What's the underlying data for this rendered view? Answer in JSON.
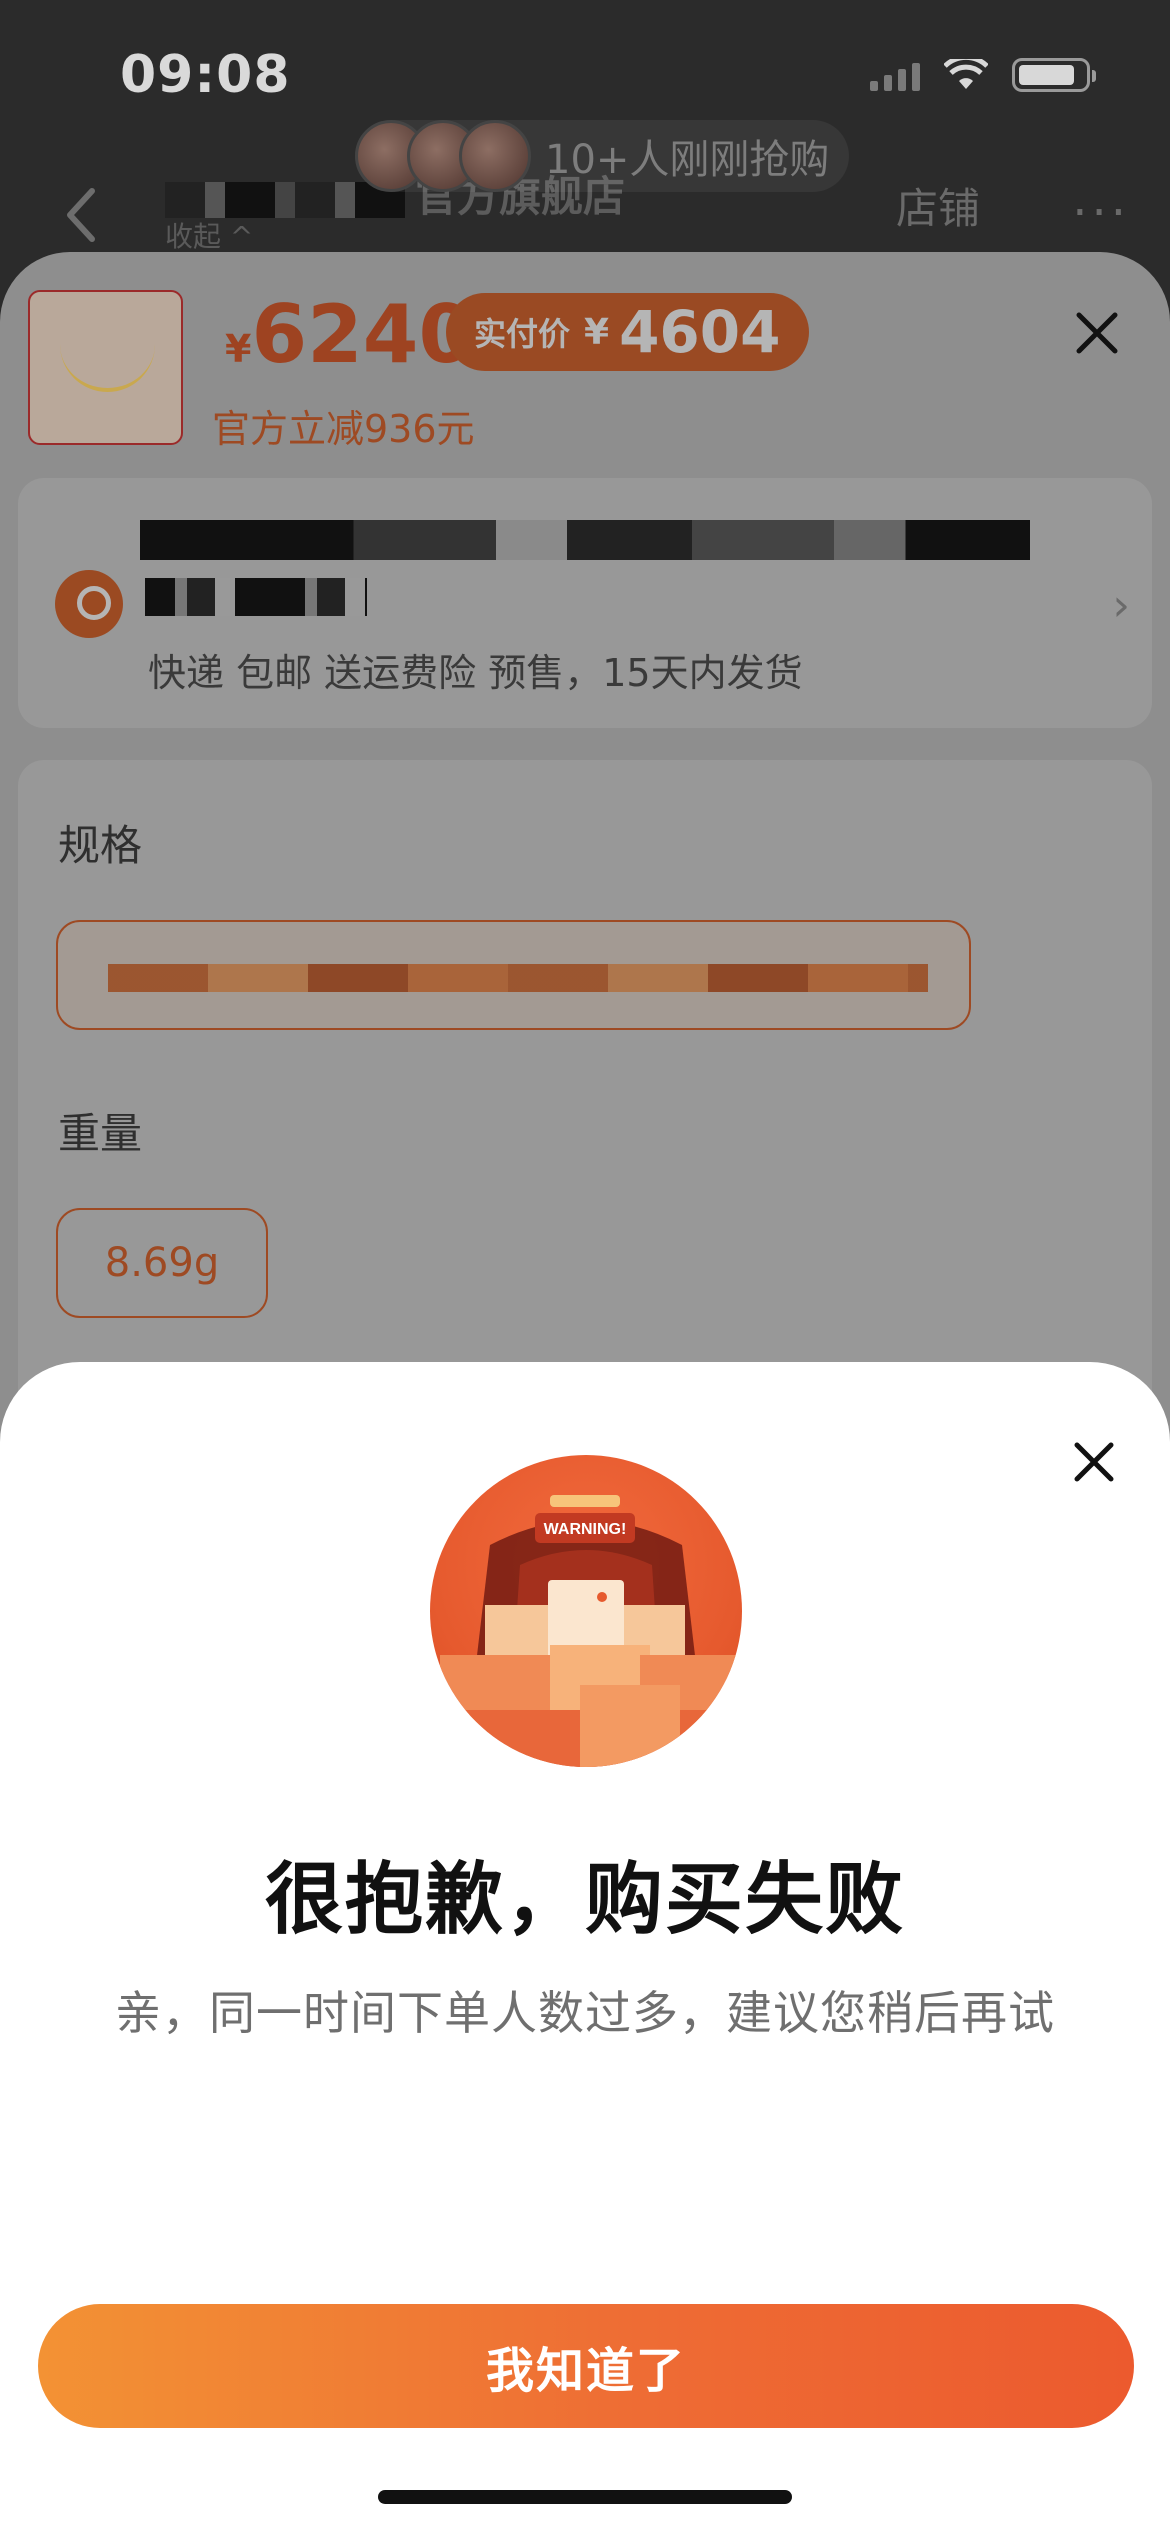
{
  "status_bar": {
    "time": "09:08"
  },
  "header": {
    "store_name": "官方旗舰店",
    "collapse": "收起 ^",
    "shop_link": "店铺",
    "more": "···"
  },
  "buyers_pill": {
    "text": "10+人刚刚抢购"
  },
  "product": {
    "currency": "¥",
    "price": "6240",
    "real_price_label": "实付价",
    "real_price_currency": "¥",
    "real_price": "4604",
    "discount_text": "官方立减936元"
  },
  "shipping": {
    "info": "快递 包邮 送运费险 预售，15天内发货",
    "chevron": "›"
  },
  "specs": {
    "spec_title": "规格",
    "weight_title": "重量",
    "weight_value": "8.69g"
  },
  "modal": {
    "title": "很抱歉，购买失败",
    "description": "亲，同一时间下单人数过多，建议您稍后再试",
    "ok_button": "我知道了",
    "illustration_sign": "WARNING!"
  },
  "colors": {
    "accent": "#EE6C34",
    "accent_start": "#F39234",
    "dim_overlay": "#8E8E8E"
  }
}
